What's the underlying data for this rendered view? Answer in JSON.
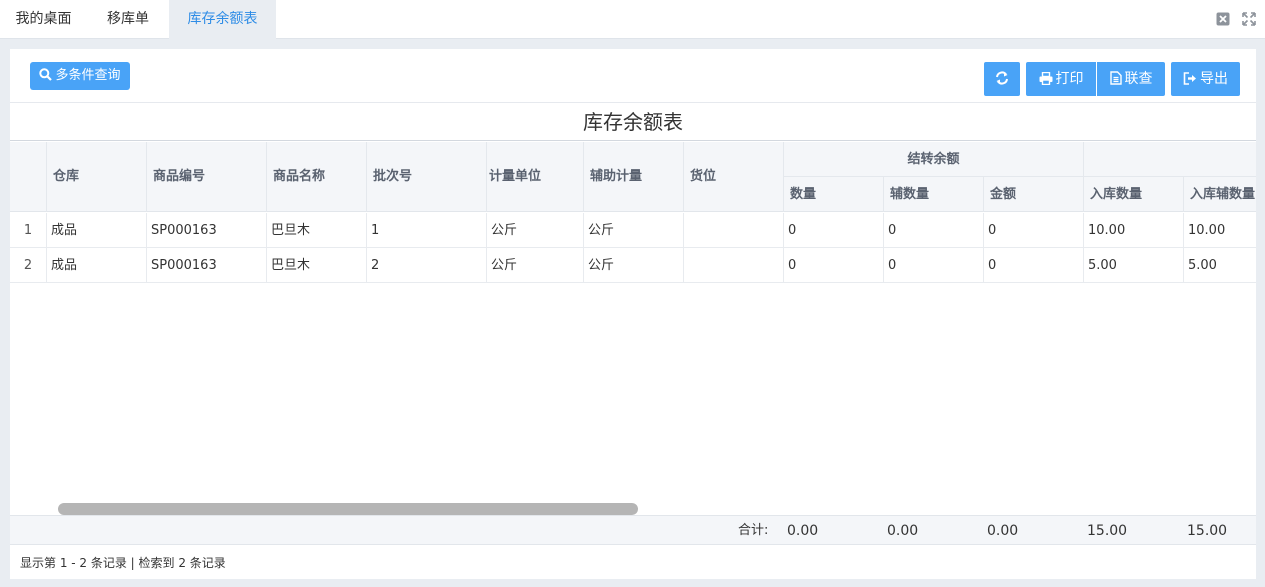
{
  "tabs": [
    {
      "label": "我的桌面",
      "active": false
    },
    {
      "label": "移库单",
      "active": false
    },
    {
      "label": "库存余额表",
      "active": true
    }
  ],
  "window_icons": [
    "close-icon",
    "maximize-icon"
  ],
  "toolbar": {
    "query_label": "多条件查询",
    "print_label": "打印",
    "link_label": "联查",
    "export_label": "导出"
  },
  "accent_color": "#49a3f7",
  "report_title": "库存余额表",
  "columns": {
    "warehouse": "仓库",
    "product_code": "商品编号",
    "product_name": "商品名称",
    "batch_no": "批次号",
    "unit": "计量单位",
    "aux_unit": "辅助计量",
    "location": "货位",
    "carry_group": "结转余额",
    "carry_qty": "数量",
    "carry_aux_qty": "辅数量",
    "carry_amount": "金额",
    "in_qty": "入库数量",
    "in_aux_qty": "入库辅数量"
  },
  "rows": [
    {
      "rn": "1",
      "warehouse": "成品",
      "product_code": "SP000163",
      "product_name": "巴旦木",
      "batch_no": "1",
      "unit": "公斤",
      "aux_unit": "公斤",
      "location": "",
      "carry_qty": "0",
      "carry_aux_qty": "0",
      "carry_amount": "0",
      "in_qty": "10.00",
      "in_aux_qty": "10.00"
    },
    {
      "rn": "2",
      "warehouse": "成品",
      "product_code": "SP000163",
      "product_name": "巴旦木",
      "batch_no": "2",
      "unit": "公斤",
      "aux_unit": "公斤",
      "location": "",
      "carry_qty": "0",
      "carry_aux_qty": "0",
      "carry_amount": "0",
      "in_qty": "5.00",
      "in_aux_qty": "5.00"
    }
  ],
  "totals": {
    "label": "合计:",
    "carry_qty": "0.00",
    "carry_aux_qty": "0.00",
    "carry_amount": "0.00",
    "in_qty": "15.00",
    "in_aux_qty": "15.00"
  },
  "pager_text": "显示第 1 - 2 条记录 | 检索到 2 条记录"
}
